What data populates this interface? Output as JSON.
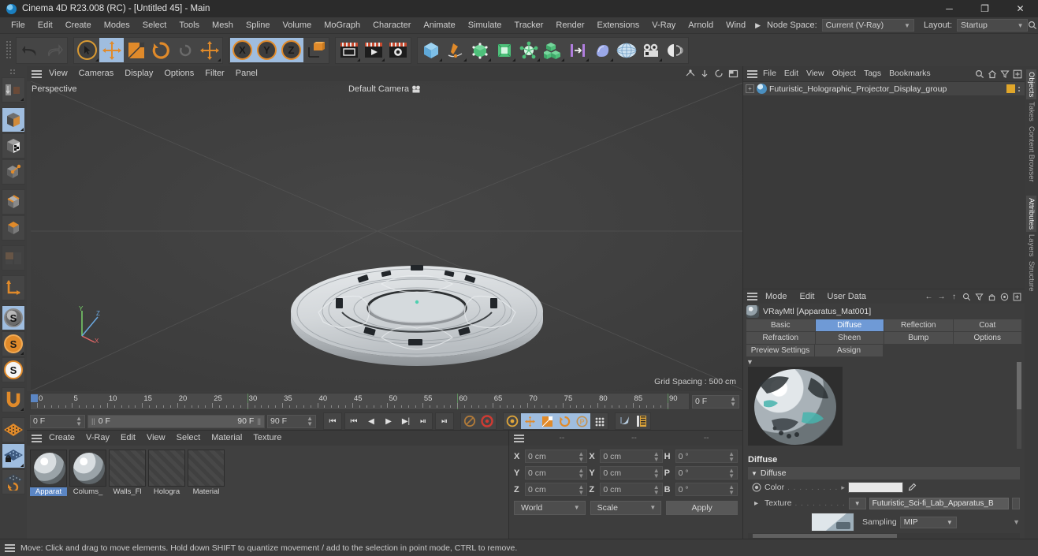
{
  "titlebar": {
    "title": "Cinema 4D R23.008 (RC) - [Untitled 45] - Main",
    "minimize": "─",
    "maximize": "❐",
    "close": "✕"
  },
  "menubar": {
    "items": [
      "File",
      "Edit",
      "Create",
      "Modes",
      "Select",
      "Tools",
      "Mesh",
      "Spline",
      "Volume",
      "MoGraph",
      "Character",
      "Animate",
      "Simulate",
      "Tracker",
      "Render",
      "Extensions",
      "V-Ray",
      "Arnold",
      "Wind"
    ],
    "overflow_arrow": "▶",
    "node_space_label": "Node Space:",
    "node_space_value": "Current (V-Ray)",
    "layout_label": "Layout:",
    "layout_value": "Startup",
    "search_icon": "⚲"
  },
  "toolbar": {
    "undo": "undo-icon",
    "redo": "redo-icon",
    "tools": [
      "select-live-icon",
      "move-icon",
      "scale-icon",
      "rotate-icon",
      "rotate-disabled-icon",
      "move-world-icon"
    ],
    "axes": [
      "X",
      "Y",
      "Z"
    ],
    "axis_world": "world-axis-icon",
    "render_group": [
      "render-view-icon",
      "render-picture-viewer-icon",
      "render-settings-icon"
    ],
    "object_group": [
      "cube-icon",
      "spline-pen-icon",
      "nurbs-icon",
      "subdiv-icon",
      "deformer-icon",
      "mograph-icon",
      "mograph-array-icon",
      "scene-icon",
      "environment-icon",
      "camera-icon",
      "light-icon"
    ]
  },
  "left_toolbar": {
    "items": [
      {
        "name": "make-editable-icon",
        "selected": false
      },
      {
        "name": "model-mode-icon",
        "selected": true
      },
      {
        "name": "texture-mode-icon",
        "selected": false
      },
      {
        "name": "points-mode-icon",
        "selected": false
      },
      {
        "name": "edges-mode-icon",
        "selected": false
      },
      {
        "name": "polygons-mode-icon",
        "selected": false
      },
      {
        "name": "viewport-solo-icon",
        "selected": false
      },
      {
        "name": "axis-modify-icon",
        "selected": false
      },
      {
        "name": "enable-axis-icon",
        "selected": true
      },
      {
        "name": "snap-mode-icon",
        "selected": false
      },
      {
        "name": "snap-settings-icon",
        "selected": false
      },
      {
        "name": "workplane-icon",
        "selected": false
      },
      {
        "name": "workplane-lock-icon",
        "selected": true
      },
      {
        "name": "workplane-rotate-icon",
        "selected": false
      }
    ]
  },
  "viewport": {
    "menu": [
      "View",
      "Cameras",
      "Display",
      "Options",
      "Filter",
      "Panel"
    ],
    "label": "Perspective",
    "camera": "Default Camera",
    "grid_spacing": "Grid Spacing : 500 cm",
    "axis_x": "X",
    "axis_y": "Y",
    "axis_z": "Z",
    "panel_icons": [
      "panel-1-view-icon",
      "panel-2-view-icon",
      "panel-4-view-icon",
      "panel-maximize-icon"
    ]
  },
  "timeline": {
    "ticks": [
      0,
      5,
      10,
      15,
      20,
      25,
      30,
      35,
      40,
      45,
      50,
      55,
      60,
      65,
      70,
      75,
      80,
      85,
      90
    ],
    "current_frame": "0 F",
    "current_frame_2": "0 F",
    "range_start": "0 F",
    "range_end": "90 F",
    "preview_end": "90 F",
    "transport": [
      "go-to-start-icon",
      "prev-key-icon",
      "prev-frame-icon",
      "play-icon",
      "next-frame-icon",
      "next-key-icon",
      "go-to-end-icon"
    ],
    "record_tools": [
      "autokey-icon",
      "record-icon",
      "keyframe-selection-icon",
      "position-key-icon",
      "scale-key-icon",
      "rotation-key-icon",
      "param-key-icon",
      "point-level-anim-icon"
    ],
    "extra": [
      "sound-icon",
      "timeline-icon"
    ]
  },
  "material_manager": {
    "menu": [
      "Create",
      "V-Ray",
      "Edit",
      "View",
      "Select",
      "Material",
      "Texture"
    ],
    "materials": [
      {
        "name": "Apparat",
        "selected": true,
        "kind": "sphere"
      },
      {
        "name": "Colums_",
        "selected": false,
        "kind": "sphere"
      },
      {
        "name": "Walls_Fl",
        "selected": false,
        "kind": "hatch"
      },
      {
        "name": "Hologra",
        "selected": false,
        "kind": "hatch"
      },
      {
        "name": "Material",
        "selected": false,
        "kind": "hatch"
      }
    ]
  },
  "coordinates": {
    "headers": [
      "--",
      "--",
      "--"
    ],
    "rows": [
      {
        "pos_label": "X",
        "pos_value": "0 cm",
        "size_label": "X",
        "size_value": "0 cm",
        "rot_label": "H",
        "rot_value": "0 °"
      },
      {
        "pos_label": "Y",
        "pos_value": "0 cm",
        "size_label": "Y",
        "size_value": "0 cm",
        "rot_label": "P",
        "rot_value": "0 °"
      },
      {
        "pos_label": "Z",
        "pos_value": "0 cm",
        "size_label": "Z",
        "size_value": "0 cm",
        "rot_label": "B",
        "rot_value": "0 °"
      }
    ],
    "world_value": "World",
    "scale_value": "Scale",
    "apply_label": "Apply"
  },
  "object_manager": {
    "menu": [
      "File",
      "Edit",
      "View",
      "Object",
      "Tags",
      "Bookmarks"
    ],
    "icons": [
      "search-icon",
      "home-icon",
      "filter-icon",
      "add-icon"
    ],
    "objects": [
      {
        "name": "Futuristic_Holographic_Projector_Display_group"
      }
    ]
  },
  "attributes": {
    "menu": [
      "Mode",
      "Edit",
      "User Data"
    ],
    "icons": [
      "back-arrow-icon",
      "forward-arrow-icon",
      "up-arrow-icon",
      "search-icon",
      "filter-icon",
      "lock-icon",
      "target-icon",
      "add-icon"
    ],
    "title": "VRayMtl [Apparatus_Mat001]",
    "tabs_row1": [
      "Basic",
      "Diffuse",
      "Reflection",
      "Coat"
    ],
    "tabs_row2": [
      "Refraction",
      "Sheen",
      "Bump",
      "Options"
    ],
    "tabs_row3": [
      "Preview Settings",
      "Assign"
    ],
    "active_tab": "Diffuse",
    "section_title": "Diffuse",
    "group_label": "Diffuse",
    "color_label": "Color",
    "color_value": "#e8e8e8",
    "texture_label": "Texture",
    "texture_value": "Futuristic_Sci-fi_Lab_Apparatus_B",
    "sampling_label": "Sampling",
    "sampling_value": "MIP"
  },
  "vertical_tabs_right": [
    {
      "label": "Objects",
      "selected": true
    },
    {
      "label": "Takes",
      "selected": false
    },
    {
      "label": "Content Browser",
      "selected": false
    },
    {
      "label": "Attributes",
      "selected": true
    },
    {
      "label": "Layers",
      "selected": false
    },
    {
      "label": "Structure",
      "selected": false
    }
  ],
  "statusbar": {
    "message": "Move: Click and drag to move elements. Hold down SHIFT to quantize movement / add to the selection in point mode, CTRL to remove."
  }
}
